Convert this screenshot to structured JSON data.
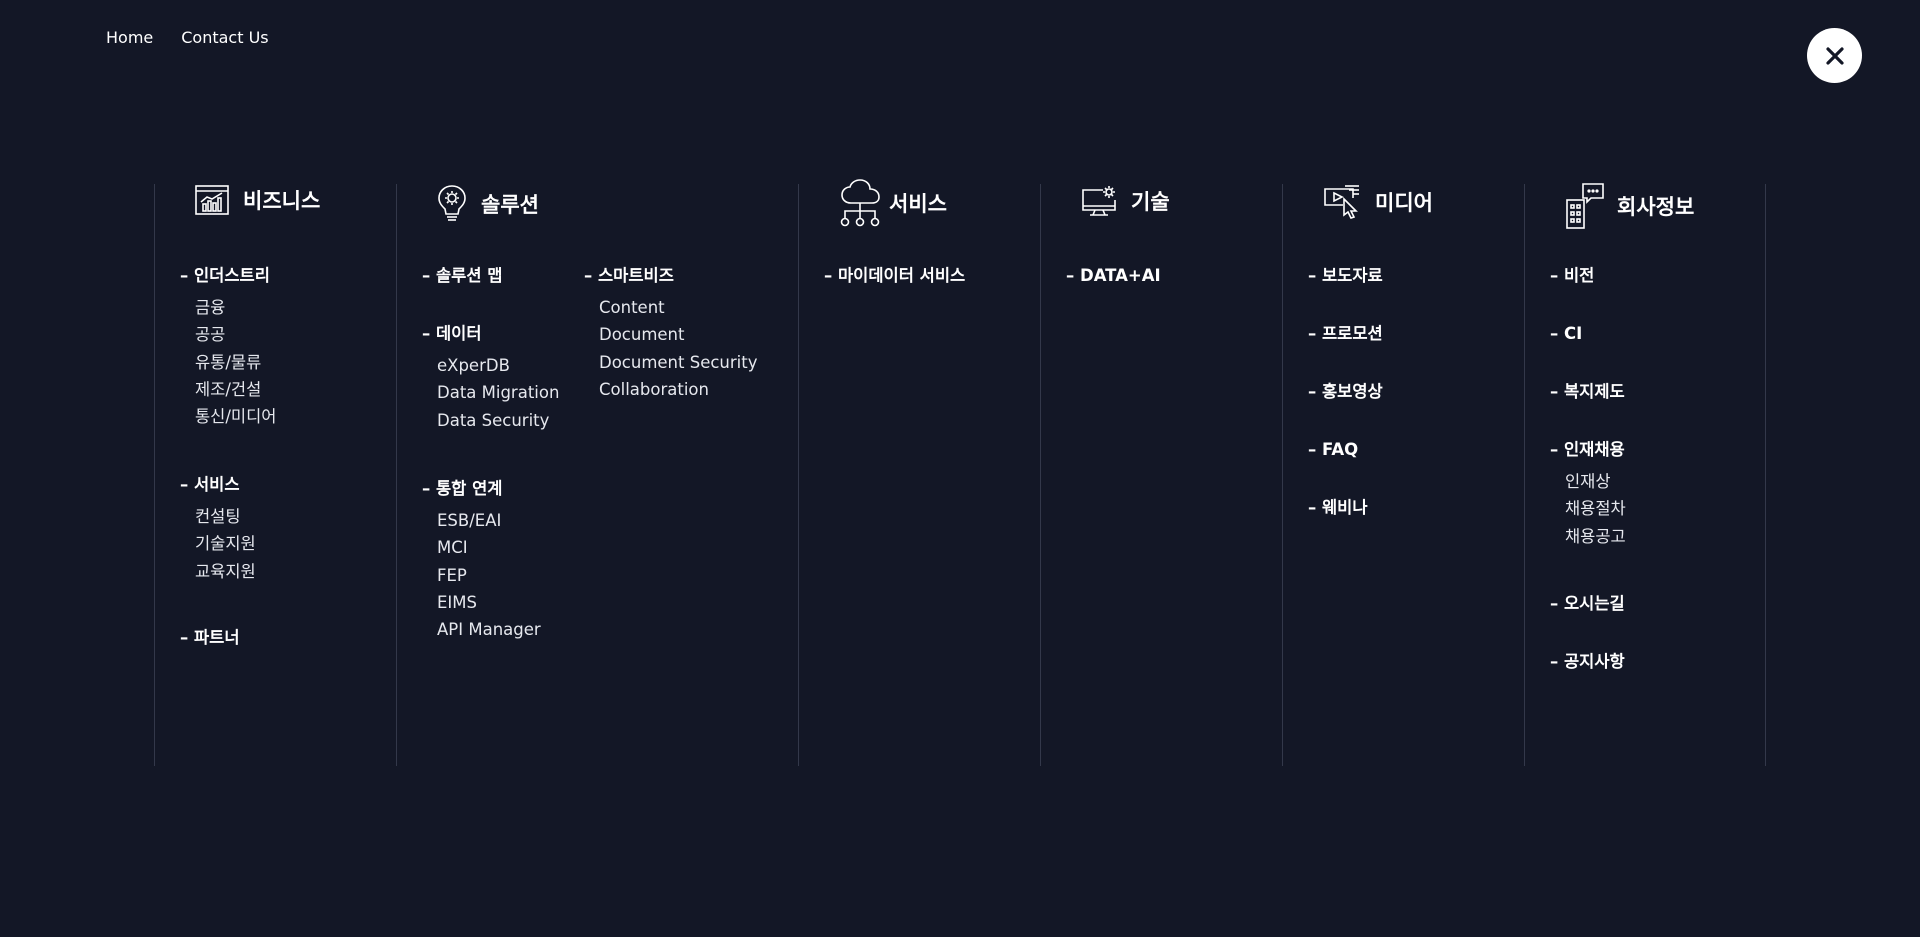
{
  "topnav": {
    "home": "Home",
    "contact": "Contact Us"
  },
  "close_icon": "close-icon",
  "columns": [
    {
      "title": "비즈니스",
      "icon": "chart-icon",
      "sections": [
        {
          "title": "인더스트리",
          "items": [
            "금융",
            "공공",
            "유통/물류",
            "제조/건설",
            "통신/미디어"
          ]
        },
        {
          "title": "서비스",
          "items": [
            "컨설팅",
            "기술지원",
            "교육지원"
          ]
        },
        {
          "title": "파트너",
          "items": []
        }
      ]
    },
    {
      "title": "솔루션",
      "icon": "lightbulb-gear-icon",
      "sections": [
        {
          "title": "솔루션 맵",
          "items": []
        },
        {
          "title": "데이터",
          "items": [
            "eXperDB",
            "Data Migration",
            "Data Security"
          ]
        },
        {
          "title": "통합 연계",
          "items": [
            "ESB/EAI",
            "MCI",
            "FEP",
            "EIMS",
            "API Manager"
          ]
        },
        {
          "title": "스마트비즈",
          "items": [
            "Content",
            "Document",
            "Document Security",
            "Collaboration"
          ]
        }
      ]
    },
    {
      "title": "서비스",
      "icon": "cloud-network-icon",
      "sections": [
        {
          "title": "마이데이터 서비스",
          "items": []
        }
      ]
    },
    {
      "title": "기술",
      "icon": "monitor-gear-icon",
      "sections": [
        {
          "title": "DATA+AI",
          "items": []
        }
      ]
    },
    {
      "title": "미디어",
      "icon": "media-cursor-icon",
      "sections": [
        {
          "title": "보도자료",
          "items": []
        },
        {
          "title": "프로모션",
          "items": []
        },
        {
          "title": "홍보영상",
          "items": []
        },
        {
          "title": "FAQ",
          "items": []
        },
        {
          "title": "웨비나",
          "items": []
        }
      ]
    },
    {
      "title": "회사정보",
      "icon": "building-chat-icon",
      "sections": [
        {
          "title": "비전",
          "items": []
        },
        {
          "title": "CI",
          "items": []
        },
        {
          "title": "복지제도",
          "items": []
        },
        {
          "title": "인재채용",
          "items": [
            "인재상",
            "채용절차",
            "채용공고"
          ]
        },
        {
          "title": "오시는길",
          "items": []
        },
        {
          "title": "공지사항",
          "items": []
        }
      ]
    }
  ]
}
